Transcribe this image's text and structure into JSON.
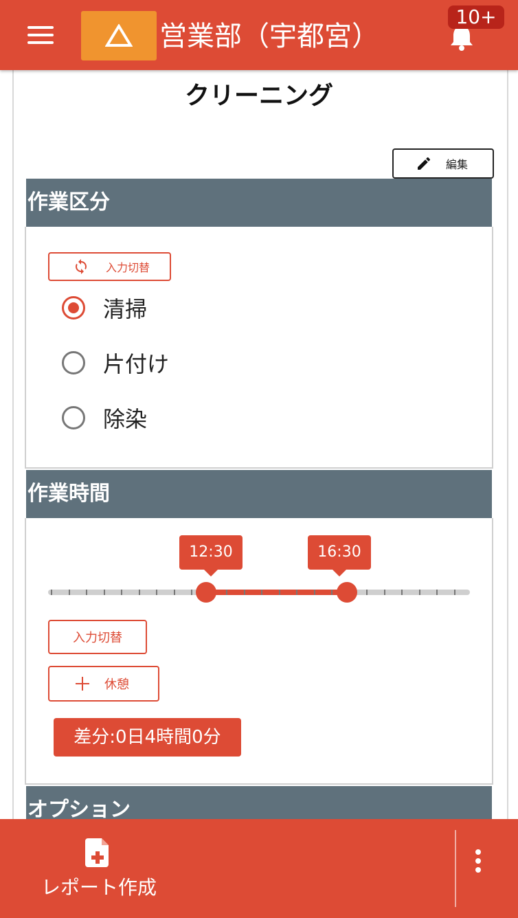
{
  "header": {
    "department": "営業部（宇都宮）",
    "notification_badge": "10+",
    "icons": [
      "menu-icon",
      "warning-triangle-icon",
      "bell-icon"
    ]
  },
  "page": {
    "title": "クリーニング",
    "edit_label": "編集"
  },
  "work_type": {
    "heading": "作業区分",
    "switch_label": "入力切替",
    "options": [
      "清掃",
      "片付け",
      "除染"
    ],
    "selected": "清掃"
  },
  "work_time": {
    "heading": "作業時間",
    "start": "12:30",
    "end": "16:30",
    "switch_label": "入力切替",
    "break_label": "休憩",
    "difference": "差分:0日4時間0分"
  },
  "options_section": {
    "heading": "オプション"
  },
  "bottom_bar": {
    "report_label": "レポート作成"
  },
  "colors": {
    "accent": "#dd4b35",
    "warning": "#f0942f",
    "section_header": "#5f717c",
    "badge": "#b8241a"
  }
}
